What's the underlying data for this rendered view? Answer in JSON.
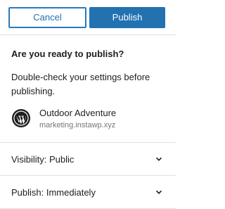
{
  "actions": {
    "cancel_label": "Cancel",
    "publish_label": "Publish"
  },
  "prepublish": {
    "heading": "Are you ready to publish?",
    "description": "Double-check your settings before publishing.",
    "site_name": "Outdoor Adventure",
    "site_url": "marketing.instawp.xyz",
    "site_icon": "wordpress-icon"
  },
  "panels": [
    {
      "label": "Visibility: Public",
      "icon": "chevron-down-icon"
    },
    {
      "label": "Publish: Immediately",
      "icon": "chevron-down-icon"
    }
  ],
  "colors": {
    "accent": "#2271b1",
    "divider": "#e0e0e0",
    "muted_text": "#757575"
  }
}
